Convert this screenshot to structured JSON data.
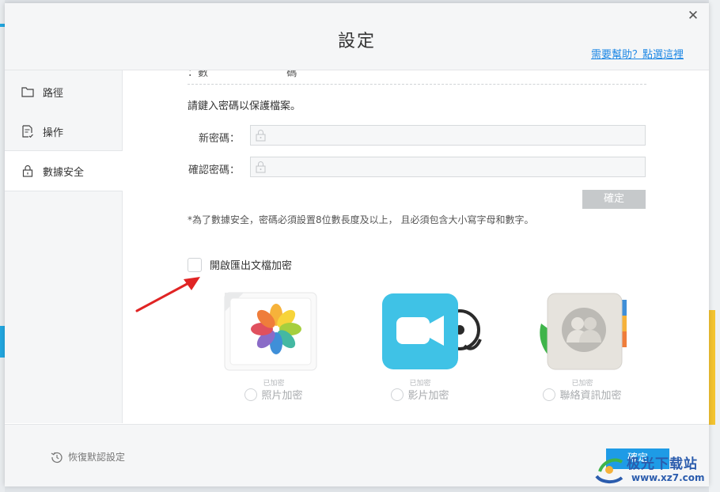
{
  "dialog": {
    "title": "設定",
    "help_link": "需要幫助？點選這裡",
    "close_glyph": "✕"
  },
  "sidebar": {
    "items": [
      {
        "label": "路徑",
        "icon": "folder-icon"
      },
      {
        "label": "操作",
        "icon": "document-icon"
      },
      {
        "label": "數據安全",
        "icon": "lock-icon",
        "active": true
      }
    ]
  },
  "security": {
    "cut_off_text": "：數 　　　　　　　 碼",
    "prompt": "請鍵入密碼以保護檔案。",
    "new_password_label": "新密碼：",
    "confirm_password_label": "確認密碼：",
    "confirm_button": "確定",
    "note": "*為了數據安全，密碼必須設置8位數長度及以上， 且必須包含大小寫字母和數字。",
    "export_encrypt_label": "開啟匯出文檔加密",
    "export_encrypt_checked": false
  },
  "apps": [
    {
      "sub": "已加密",
      "label": "照片加密",
      "icon": "photos-icon"
    },
    {
      "sub": "已加密",
      "label": "影片加密",
      "icon": "video-icon"
    },
    {
      "sub": "已加密",
      "label": "聯絡資訊加密",
      "icon": "contacts-icon"
    }
  ],
  "footer": {
    "restore_label": "恢復默認設定",
    "ok_button": "確定"
  },
  "watermark": {
    "text": "极光下载站",
    "url": "www.xz7.com"
  },
  "colors": {
    "accent": "#1e9be6",
    "link": "#1e88e5",
    "arrow": "#e02424",
    "disabled_button": "#c6c9cb"
  }
}
